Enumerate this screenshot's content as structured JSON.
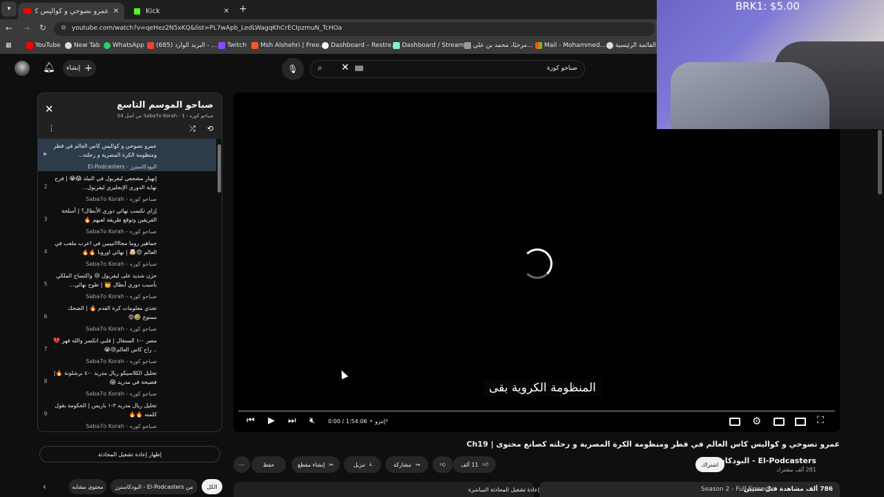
{
  "browser": {
    "tabs": [
      {
        "title": "عمرو نصوحي و كواليس كاس الن",
        "active": true
      },
      {
        "title": "Kick",
        "active": false
      }
    ],
    "url": "youtube.com/watch?v=qeHez2N5xKQ&list=PL7wApb_LedLWagqKhCrECIpzmuN_TcHOa",
    "bookmarks": [
      "YouTube",
      "New Tab",
      "WhatsApp",
      "(685) البريد الوارد - ...",
      "Twitch",
      "Msh Alshehri | Free...",
      "Dashboard – Restre...",
      "Dashboard / Stream...",
      "مرحبًا، محمد بن علي...",
      "Mail - Mohammed...",
      "القائمة الرئيسية"
    ]
  },
  "header": {
    "create_label": "إنشاء",
    "search_value": "صباحو كورة"
  },
  "playlist": {
    "title": "صباحو الموسم التاسع",
    "subtitle": "صباحو كوره - Saba7o Korah - 1 من أصل 54",
    "items": [
      {
        "num": "▶",
        "title": "عمرو نصوحي و كواليس كاس العالم في قطر ومنظومة الكرة المصرية و رحلته...",
        "channel": "البودكاسترز - El-Podcasters",
        "active": true
      },
      {
        "num": "2",
        "title": "إنهيار مشجعي ليفربول في النيلد 😱😭 | فرح نهاية الدوري الإنجليزي ليفربول...",
        "channel": "صباحو كوره - Saba7o Korah"
      },
      {
        "num": "3",
        "title": "إزاي تكسب نهائي دوري الأبطال؟ | أسلحة الفريقين وتوقع طريقة لعبهم 🔥",
        "channel": "صباحو كوره - Saba7o Korah"
      },
      {
        "num": "4",
        "title": "جماهير روما مجاااانيييين في اعرب ملعب في العالم 😍🤯 | نهائي اوروبا 🔥🔥",
        "channel": "صباحو كوره - Saba7o Korah"
      },
      {
        "num": "5",
        "title": "حزن شديد على ليفربول 😢 واكتساح الملكي بأسبب دوري أبطال 👑 | طوح نهائي...",
        "channel": "صباحو كوره - Saba7o Korah"
      },
      {
        "num": "6",
        "title": "تحدي معلومات كرة القدم 🔥 | الضحك ممنوع 🤣😡",
        "channel": "صباحو كوره - Saba7o Korah"
      },
      {
        "num": "7",
        "title": "مصر ٠-١ السنغال | قلبي اتكسر والله فهر 💔 .. راح كاس العالم😢😭",
        "channel": "صباحو كوره - Saba7o Korah"
      },
      {
        "num": "8",
        "title": "تحليل الكلاسيكو ريال مدريد ٠-٤ برشلونة 🔥| فضيحة في مدريد 😱",
        "channel": "صباحو كوره - Saba7o Korah"
      },
      {
        "num": "9",
        "title": "تحليل ريال مدريد ٣-١ باريس | الحكومة بقول كلمته 🔥🔥",
        "channel": "صباحو كوره - Saba7o Korah"
      }
    ],
    "chat_replay_label": "إظهار إعادة تشغيل المحادثة"
  },
  "player": {
    "caption": "المنظومة الكروية بقى",
    "time": "0:00 / 1:54:06",
    "chapter": "إنترو",
    "progress": 0.0
  },
  "video": {
    "title": "عمرو نصوحي و كواليس كاس العالم في قطر ومنظومة الكرة المصرية و رحلته كصانع محتوى | Ch19",
    "channel": "El-Podcasters - البودكاسترز",
    "subscribers": "281 ألف مشترك",
    "subscribe_label": "اشتراك",
    "likes": "11 ألف",
    "share_label": "مشاركة",
    "download_label": "تنزيل",
    "clip_label": "إنشاء مقطع",
    "save_label": "حفظ",
    "views": "786 ألف مشاهدة قبل سنتين",
    "season": "Season 2 - Full Episodes",
    "live_chat_replay": "إعادة تشغيل المحادثة المباشرة"
  },
  "filters": {
    "chips": [
      "الكل",
      "من El-Podcasters - البودكاسترز",
      "محتوى مشابه"
    ]
  },
  "overlay": {
    "donation_text": "BRK1: $5.00"
  },
  "colors": {
    "youtube_red": "#ff0000",
    "kick_green": "#53fc18",
    "active_item": "#2d3c4a"
  }
}
